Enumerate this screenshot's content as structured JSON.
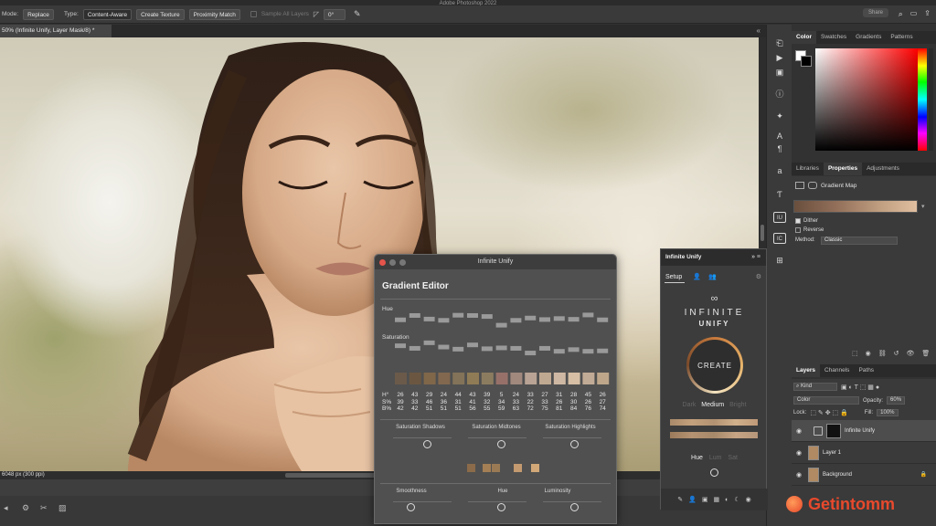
{
  "app": {
    "title": "Adobe Photoshop 2022",
    "share_label": "Share"
  },
  "optbar": {
    "mode_label": "Mode:",
    "mode_value": "Replace",
    "type_label": "Type:",
    "type_buttons": [
      "Content-Aware",
      "Create Texture",
      "Proximity Match"
    ],
    "sample_all_layers": "Sample All Layers",
    "angle_value": "0°"
  },
  "document": {
    "tab_title": "50% (Infinite Unify, Layer Mask/8) *",
    "status": "6048 px (300 ppi)"
  },
  "color_panel": {
    "tabs": [
      "Color",
      "Swatches",
      "Gradients",
      "Patterns"
    ],
    "active": "Color"
  },
  "properties_panel": {
    "tabs": [
      "Libraries",
      "Properties",
      "Adjustments"
    ],
    "active": "Properties",
    "adjustment": "Gradient Map",
    "dither": "Dither",
    "reverse": "Reverse",
    "method_label": "Method:",
    "method_value": "Classic"
  },
  "layers_panel": {
    "tabs": [
      "Layers",
      "Channels",
      "Paths"
    ],
    "active": "Layers",
    "kind_label": "Kind",
    "blend_mode": "Color",
    "opacity_label": "Opacity:",
    "opacity_value": "60%",
    "lock_label": "Lock:",
    "fill_label": "Fill:",
    "fill_value": "100%",
    "layers": [
      {
        "name": "Infinite Unify",
        "selected": true
      },
      {
        "name": "Layer 1",
        "selected": false
      },
      {
        "name": "Background",
        "selected": false
      }
    ]
  },
  "gradient_editor": {
    "window_title": "Infinite Unify",
    "heading": "Gradient Editor",
    "hue_label": "Hue",
    "saturation_label": "Saturation",
    "row_labels": [
      "H°",
      "S%",
      "B%"
    ],
    "hue_values": [
      "26",
      "43",
      "29",
      "24",
      "44",
      "43",
      "39",
      "5",
      "24",
      "33",
      "27",
      "31",
      "28",
      "45",
      "26"
    ],
    "sat_values": [
      "39",
      "33",
      "46",
      "36",
      "31",
      "41",
      "32",
      "34",
      "33",
      "22",
      "33",
      "26",
      "30",
      "26",
      "27"
    ],
    "bri_values": [
      "42",
      "42",
      "51",
      "51",
      "51",
      "56",
      "55",
      "59",
      "63",
      "72",
      "75",
      "81",
      "84",
      "76",
      "74"
    ],
    "swatch_colors": [
      "#6b5a4a",
      "#6b5741",
      "#806749",
      "#82684f",
      "#837358",
      "#8f7b55",
      "#8c7c5f",
      "#977169",
      "#a1897e",
      "#b8a394",
      "#bfa991",
      "#cfb8a3",
      "#d6bfa5",
      "#c2ab96",
      "#bda68a"
    ],
    "slider_captions_top": [
      "Saturation Shadows",
      "Saturation Midtones",
      "Saturation Highlights"
    ],
    "slider_captions_bottom": [
      "Smoothness",
      "Hue",
      "Luminosity"
    ],
    "mini_swatches": [
      "#8b6b4a",
      "#a47f55",
      "#9a7a55",
      "#c49a70",
      "#d2a878"
    ]
  },
  "unify_panel": {
    "title": "Infinite Unify",
    "setup_label": "Setup",
    "logo_line1": "INFINITE",
    "logo_line2": "UNIFY",
    "create_label": "CREATE",
    "modes": [
      "Dark",
      "Medium",
      "Bright"
    ],
    "active_mode": "Medium",
    "sliders": [
      "Hue",
      "Lum",
      "Sat"
    ],
    "active_slider": "Hue"
  },
  "watermark": {
    "text": "Getintomm"
  }
}
